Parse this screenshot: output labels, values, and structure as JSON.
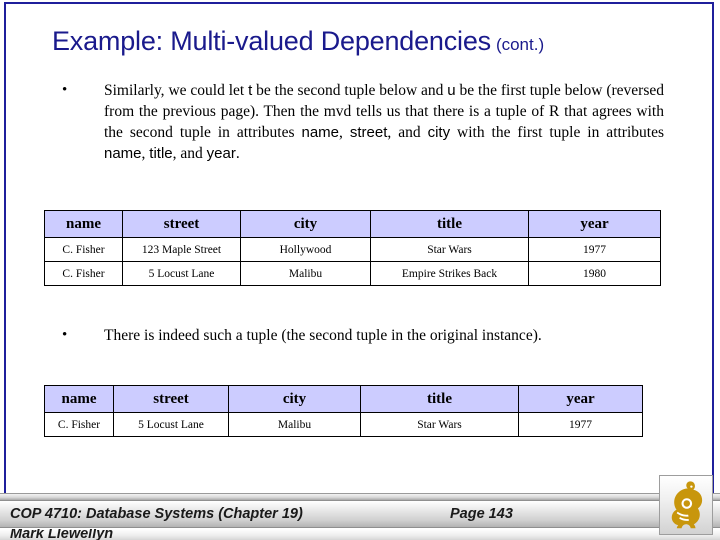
{
  "slide": {
    "title_main": "Example: Multi-valued Dependencies",
    "title_cont": "(cont.)",
    "accent_color": "#1a1a8c",
    "table_header_color": "#ccccff",
    "logo_color": "#c8960c"
  },
  "bullets": [
    {
      "marker": "•",
      "segments": [
        {
          "text": "Similarly, we could let ",
          "style": "serif"
        },
        {
          "text": "t",
          "style": "sans"
        },
        {
          "text": " be the second tuple below and ",
          "style": "serif"
        },
        {
          "text": "u",
          "style": "sans"
        },
        {
          "text": " be the first tuple below (reversed from the previous page).  Then the mvd tells us that there is a tuple of R that agrees with the second tuple in attributes ",
          "style": "serif"
        },
        {
          "text": "name",
          "style": "sans"
        },
        {
          "text": ", ",
          "style": "serif"
        },
        {
          "text": "street",
          "style": "sans"
        },
        {
          "text": ", and ",
          "style": "serif"
        },
        {
          "text": "city",
          "style": "sans"
        },
        {
          "text": " with the first tuple in attributes ",
          "style": "serif"
        },
        {
          "text": "name",
          "style": "sans"
        },
        {
          "text": ", ",
          "style": "serif"
        },
        {
          "text": "title",
          "style": "sans"
        },
        {
          "text": ", and ",
          "style": "serif"
        },
        {
          "text": "year",
          "style": "sans"
        },
        {
          "text": ".",
          "style": "serif"
        }
      ]
    },
    {
      "marker": "•",
      "segments": [
        {
          "text": "There is indeed such a tuple (the second tuple in the original instance).",
          "style": "serif"
        }
      ]
    }
  ],
  "table_1": {
    "name": "relation-instance-two-tuples",
    "columns": [
      "name",
      "street",
      "city",
      "title",
      "year"
    ],
    "rows": [
      [
        "C. Fisher",
        "123 Maple Street",
        "Hollywood",
        "Star Wars",
        "1977"
      ],
      [
        "C. Fisher",
        "5 Locust Lane",
        "Malibu",
        "Empire Strikes Back",
        "1980"
      ]
    ]
  },
  "table_2": {
    "name": "relation-instance-implied-tuple",
    "columns": [
      "name",
      "street",
      "city",
      "title",
      "year"
    ],
    "rows": [
      [
        "C. Fisher",
        "5 Locust Lane",
        "Malibu",
        "Star Wars",
        "1977"
      ]
    ]
  },
  "footer": {
    "course": "COP 4710: Database Systems  (Chapter 19)",
    "page": "Page 143",
    "author": "Mark Llewellyn",
    "logo_name": "ucf-pegasus-logo"
  }
}
